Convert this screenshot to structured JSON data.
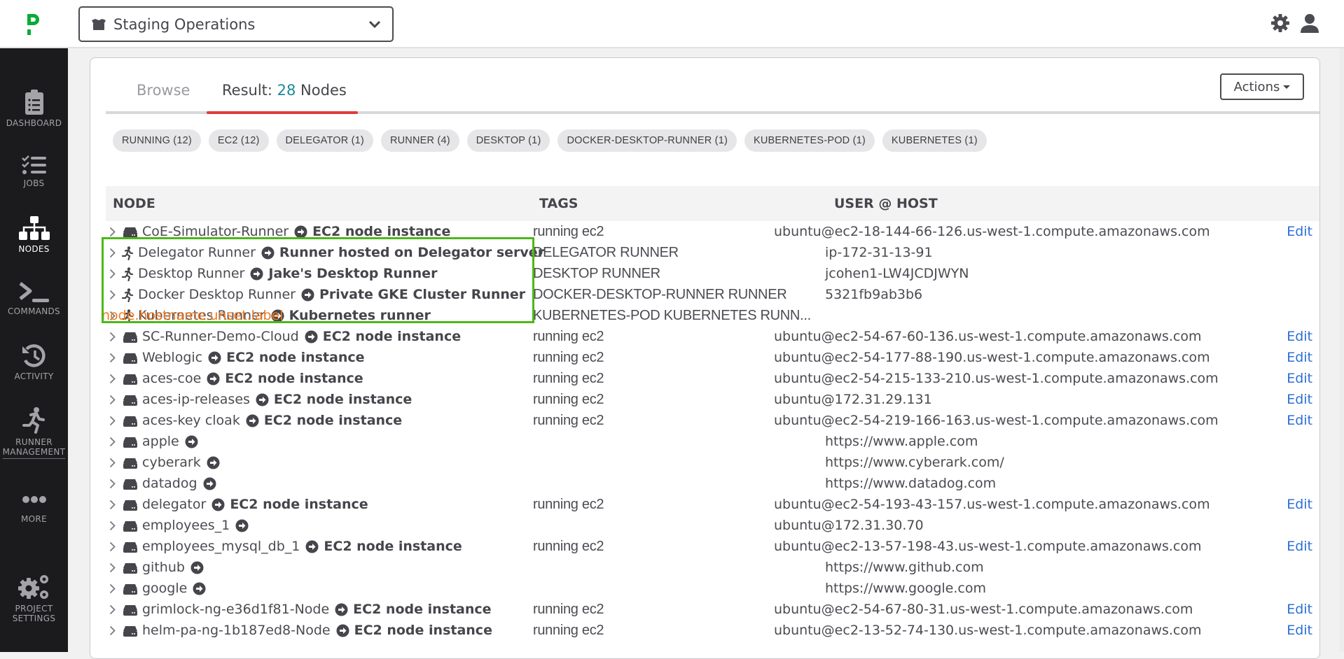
{
  "topbar": {
    "logo": "pagerduty-p-logo",
    "project": "Staging Operations",
    "icons": [
      "gear-icon",
      "user-icon"
    ]
  },
  "sidebar": {
    "items": [
      {
        "label": "DASHBOARD",
        "icon": "clipboard-list-icon",
        "active": false
      },
      {
        "label": "JOBS",
        "icon": "checklist-icon",
        "active": false
      },
      {
        "label": "NODES",
        "icon": "sitemap-icon",
        "active": true
      },
      {
        "label": "COMMANDS",
        "icon": "terminal-icon",
        "active": false
      },
      {
        "label": "ACTIVITY",
        "icon": "history-icon",
        "active": false
      },
      {
        "label_line1": "RUNNER",
        "label_line2": "MANAGEMENT",
        "icon": "runner-icon",
        "active": false
      },
      {
        "label": "MORE",
        "icon": "ellipsis-icon",
        "active": false
      },
      {
        "label_line1": "PROJECT",
        "label_line2": "SETTINGS",
        "icon": "cogs-icon",
        "active": false
      }
    ]
  },
  "tabs": {
    "browse": "Browse",
    "result_prefix": "Result: ",
    "result_count": "28",
    "result_suffix": " Nodes"
  },
  "actions_label": "Actions",
  "filters": [
    "RUNNING (12)",
    "EC2 (12)",
    "DELEGATOR (1)",
    "RUNNER (4)",
    "DESKTOP (1)",
    "DOCKER-DESKTOP-RUNNER (1)",
    "KUBERNETES-POD (1)",
    "KUBERNETES (1)"
  ],
  "table": {
    "headers": {
      "node": "NODE",
      "tags": "TAGS",
      "userhost": "USER @ HOST"
    },
    "rows": [
      {
        "type": "server",
        "name": "CoE-Simulator-Runner",
        "desc": "EC2 node instance",
        "tags": "running ec2",
        "userhost": "ubuntu@ec2-18-144-66-126.us-west-1.compute.amazonaws.com",
        "style": "ssh",
        "edit": "Edit"
      },
      {
        "type": "runner",
        "name": "Delegator Runner",
        "desc": "Runner hosted on Delegator server",
        "tags": "DELEGATOR RUNNER",
        "userhost": "ip-172-31-13-91",
        "style": "plain",
        "edit": ""
      },
      {
        "type": "runner",
        "name": "Desktop Runner",
        "desc": "Jake's Desktop Runner",
        "tags": "DESKTOP RUNNER",
        "userhost": "jcohen1-LW4JCDJWYN",
        "style": "plain",
        "edit": ""
      },
      {
        "type": "runner",
        "name": "Docker Desktop Runner",
        "desc": "Private GKE Cluster Runner",
        "tags": "DOCKER-DESKTOP-RUNNER RUNNER",
        "userhost": "5321fb9ab3b6",
        "style": "plain",
        "edit": ""
      },
      {
        "type": "runner",
        "name": "Kubernetes Runner",
        "desc": "Kubernetes runner",
        "tags": "KUBERNETES-POD KUBERNETES RUNN...",
        "userhost": "node.hostname.unset.label",
        "style": "warn",
        "edit": ""
      },
      {
        "type": "server",
        "name": "SC-Runner-Demo-Cloud",
        "desc": "EC2 node instance",
        "tags": "running ec2",
        "userhost": "ubuntu@ec2-54-67-60-136.us-west-1.compute.amazonaws.com",
        "style": "ssh",
        "edit": "Edit"
      },
      {
        "type": "server",
        "name": "Weblogic",
        "desc": "EC2 node instance",
        "tags": "running ec2",
        "userhost": "ubuntu@ec2-54-177-88-190.us-west-1.compute.amazonaws.com",
        "style": "ssh",
        "edit": "Edit"
      },
      {
        "type": "server",
        "name": "aces-coe",
        "desc": "EC2 node instance",
        "tags": "running ec2",
        "userhost": "ubuntu@ec2-54-215-133-210.us-west-1.compute.amazonaws.com",
        "style": "ssh",
        "edit": "Edit"
      },
      {
        "type": "server",
        "name": "aces-ip-releases",
        "desc": "EC2 node instance",
        "tags": "running ec2",
        "userhost": "ubuntu@172.31.29.131",
        "style": "ssh",
        "edit": "Edit"
      },
      {
        "type": "server",
        "name": "aces-key cloak",
        "desc": "EC2 node instance",
        "tags": "running ec2",
        "userhost": "ubuntu@ec2-54-219-166-163.us-west-1.compute.amazonaws.com",
        "style": "ssh",
        "edit": "Edit"
      },
      {
        "type": "server",
        "name": "apple",
        "desc": "",
        "tags": "",
        "userhost": "https://www.apple.com",
        "style": "plain",
        "edit": ""
      },
      {
        "type": "server",
        "name": "cyberark",
        "desc": "",
        "tags": "",
        "userhost": "https://www.cyberark.com/",
        "style": "plain",
        "edit": ""
      },
      {
        "type": "server",
        "name": "datadog",
        "desc": "",
        "tags": "",
        "userhost": "https://www.datadog.com",
        "style": "plain",
        "edit": ""
      },
      {
        "type": "server",
        "name": "delegator",
        "desc": "EC2 node instance",
        "tags": "running ec2",
        "userhost": "ubuntu@ec2-54-193-43-157.us-west-1.compute.amazonaws.com",
        "style": "ssh",
        "edit": "Edit"
      },
      {
        "type": "server",
        "name": "employees_1",
        "desc": "",
        "tags": "",
        "userhost": "ubuntu@172.31.30.70",
        "style": "ssh",
        "edit": ""
      },
      {
        "type": "server",
        "name": "employees_mysql_db_1",
        "desc": "EC2 node instance",
        "tags": "running ec2",
        "userhost": "ubuntu@ec2-13-57-198-43.us-west-1.compute.amazonaws.com",
        "style": "ssh",
        "edit": "Edit"
      },
      {
        "type": "server",
        "name": "github",
        "desc": "",
        "tags": "",
        "userhost": "https://www.github.com",
        "style": "plain",
        "edit": ""
      },
      {
        "type": "server",
        "name": "google",
        "desc": "",
        "tags": "",
        "userhost": "https://www.google.com",
        "style": "plain",
        "edit": ""
      },
      {
        "type": "server",
        "name": "grimlock-ng-e36d1f81-Node",
        "desc": "EC2 node instance",
        "tags": "running ec2",
        "userhost": "ubuntu@ec2-54-67-80-31.us-west-1.compute.amazonaws.com",
        "style": "ssh",
        "edit": "Edit"
      },
      {
        "type": "server",
        "name": "helm-pa-ng-1b187ed8-Node",
        "desc": "EC2 node instance",
        "tags": "running ec2",
        "userhost": "ubuntu@ec2-13-52-74-130.us-west-1.compute.amazonaws.com",
        "style": "ssh",
        "edit": "Edit"
      }
    ]
  },
  "colors": {
    "accent_tab": "#e03a3e",
    "count": "#1b8a96",
    "link": "#2b6fd6",
    "warning": "#f07a22",
    "highlight_box": "#4cb81a",
    "logo": "#06ac38"
  }
}
